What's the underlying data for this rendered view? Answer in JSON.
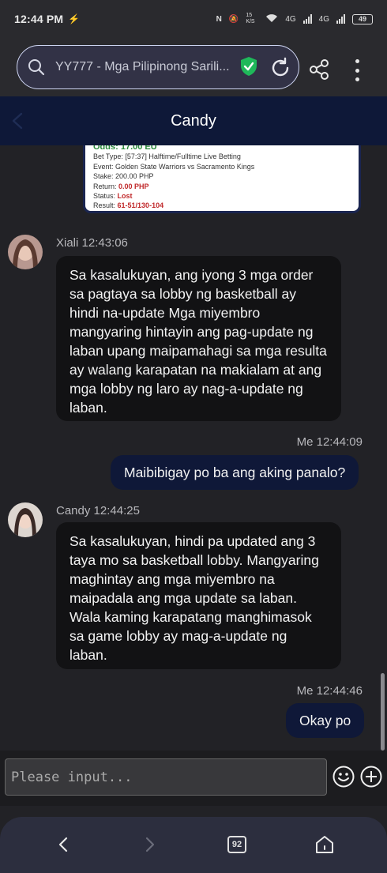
{
  "status_bar": {
    "time": "12:44 PM",
    "net_speed": "15 K/S",
    "net1": "4G",
    "net2": "4G",
    "battery": "49"
  },
  "browser": {
    "url_text": "YY777 - Mga Pilipinong Sarili..."
  },
  "chat_header": {
    "title": "Candy"
  },
  "bet_card": {
    "odds": "Odds: 17.00 EU",
    "bet_type": "Bet Type: [57:37] Halftime/Fulltime Live Betting",
    "event": "Event: Golden State Warriors vs Sacramento Kings",
    "stake": "Stake: 200.00 PHP",
    "return_label": "Return:",
    "return_value": "0.00 PHP",
    "status_label": "Status:",
    "status_value": "Lost",
    "result_label": "Result:",
    "result_value": "61-51/130-104"
  },
  "messages": [
    {
      "sender": "Xiali 12:43:06",
      "text": "Sa kasalukuyan, ang iyong 3 mga order sa pagtaya sa lobby ng basketball ay hindi na-update Mga miyembro mangyaring hintayin ang pag-update ng laban upang maipamahagi sa mga resulta ay walang karapatan na makialam at ang mga lobby ng laro ay nag-a-update ng laban."
    },
    {
      "sender": "Me 12:44:09",
      "text": "Maibibigay po ba ang aking panalo?"
    },
    {
      "sender": "Candy 12:44:25",
      "text": "Sa kasalukuyan, hindi pa updated ang 3 taya mo sa basketball lobby. Mangyaring maghintay ang mga miyembro na maipadala ang mga update sa laban. Wala kaming karapatang manghimasok sa game lobby ay mag-a-update ng laban."
    },
    {
      "sender": "Me 12:44:46",
      "text": "Okay po"
    }
  ],
  "input": {
    "placeholder": "Please input..."
  },
  "nav": {
    "tab_count": "92"
  },
  "colors": {
    "header_bg": "#0e1838",
    "my_bubble": "#0f1838",
    "their_bubble": "#121214",
    "loss_red": "#c0282a",
    "shield_green": "#1fb85a"
  },
  "icons": [
    "search-icon",
    "shield-check-icon",
    "reload-icon",
    "share-icon",
    "more-vert-icon",
    "back-icon",
    "emoji-icon",
    "plus-icon",
    "nav-back-icon",
    "nav-forward-icon",
    "tabs-icon",
    "home-icon"
  ]
}
